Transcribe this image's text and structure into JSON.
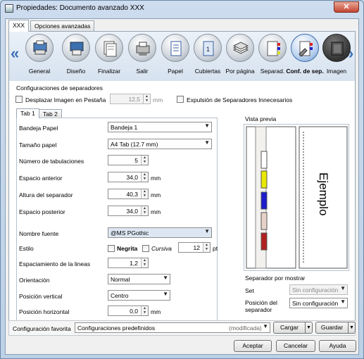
{
  "window": {
    "title": "Propiedades: Documento avanzado XXX",
    "close": "✕"
  },
  "tabs": [
    "XXX",
    "Opciones avanzadas"
  ],
  "features": [
    {
      "label": "General"
    },
    {
      "label": "Diseño"
    },
    {
      "label": "Finalizar"
    },
    {
      "label": "Salir"
    },
    {
      "label": "Papel"
    },
    {
      "label": "Cubiertas"
    },
    {
      "label": "Por página"
    },
    {
      "label": "Separad."
    },
    {
      "label": "Conf. de sep."
    },
    {
      "label": "Imagen"
    }
  ],
  "section_title": "Configuraciones de separadores",
  "shift_image": {
    "label": "Desplazar Imagen en Pestaña",
    "value": "12,5",
    "unit": "mm"
  },
  "eject_separators": "Expulsión de Separadores Innecesarios",
  "subtabs": [
    "Tab 1",
    "Tab 2"
  ],
  "form": {
    "bandeja_label": "Bandeja Papel",
    "bandeja_value": "Bandeja 1",
    "tamano_label": "Tamaño papel",
    "tamano_value": "A4 Tab (12.7 mm)",
    "num_tab_label": "Número de tabulaciones",
    "num_tab_value": "5",
    "esp_ant_label": "Espacio anterior",
    "esp_ant_value": "34,0",
    "altura_label": "Altura del separador",
    "altura_value": "40,3",
    "esp_post_label": "Espacio posterior",
    "esp_post_value": "34,0",
    "fuente_label": "Nombre fuente",
    "fuente_value": "@MS PGothic",
    "estilo_label": "Estilo",
    "negrita": "Negrita",
    "cursiva": "Cursiva",
    "size_value": "12",
    "size_unit": "pt",
    "espaciamiento_label": "Espaciamiento de la lineas",
    "espaciamiento_value": "1,2",
    "orient_label": "Orientación",
    "orient_value": "Normal",
    "pos_vert_label": "Posición vertical",
    "pos_vert_value": "Centro",
    "pos_hor_label": "Posición horizontal",
    "pos_hor_value": "0,0",
    "mm": "mm"
  },
  "preview": {
    "title": "Vista previa",
    "sample_text": "Ejemplo",
    "tab_colors": [
      "#ffffff",
      "#e8e800",
      "#1c1ccc",
      "#e8d2c8",
      "#b02020"
    ],
    "sep_mostrar": "Separador por mostrar",
    "set_label": "Set",
    "set_value": "Sin configuración",
    "pos_sep_label": "Posición del separador",
    "pos_sep_value": "Sin configuración"
  },
  "favorites": {
    "label": "Configuración favorita",
    "value": "Configuraciones predefinidos",
    "modified": "(modificada)",
    "load": "Cargar",
    "save": "Guardar"
  },
  "buttons": {
    "ok": "Aceptar",
    "cancel": "Cancelar",
    "help": "Ayuda"
  }
}
